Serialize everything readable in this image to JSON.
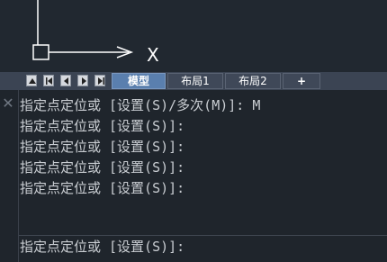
{
  "viewport": {
    "axis_x_label": "X"
  },
  "tabs": [
    {
      "label": "模型",
      "active": true
    },
    {
      "label": "布局1",
      "active": false
    },
    {
      "label": "布局2",
      "active": false
    },
    {
      "label": "+",
      "active": false
    }
  ],
  "nav_icons": [
    "triangle-up-icon",
    "first-icon",
    "previous-icon",
    "next-icon",
    "last-icon"
  ],
  "command": {
    "history": [
      "指定点定位或 [设置(S)/多次(M)]: M",
      "指定点定位或 [设置(S)]:",
      "指定点定位或 [设置(S)]:",
      "指定点定位或 [设置(S)]:",
      "指定点定位或 [设置(S)]:"
    ],
    "prompt": "指定点定位或 [设置(S)]:",
    "close_glyph": "✕"
  },
  "colors": {
    "active_tab": "#5a7fae",
    "background": "#212830"
  }
}
